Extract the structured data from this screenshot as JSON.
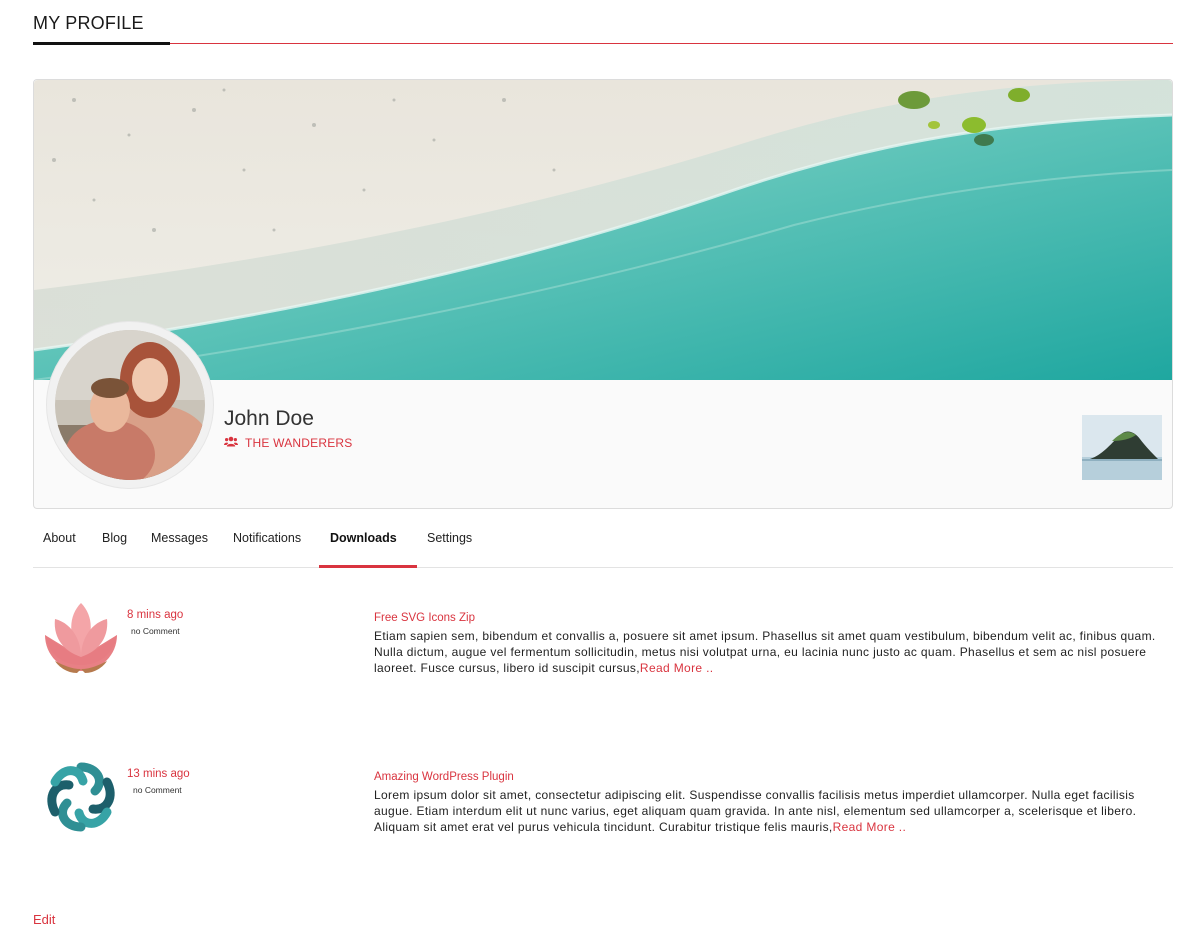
{
  "header": {
    "title": "MY PROFILE"
  },
  "profile": {
    "name": "John Doe",
    "group_label": "THE WANDERERS",
    "group_icon": "users-icon"
  },
  "tabs": [
    {
      "label": "About"
    },
    {
      "label": "Blog"
    },
    {
      "label": "Messages"
    },
    {
      "label": "Notifications"
    },
    {
      "label": "Downloads",
      "active": true
    },
    {
      "label": "Settings"
    }
  ],
  "downloads": [
    {
      "time": "8 mins ago",
      "comments": "no Comment",
      "title": "Free SVG Icons Zip",
      "text": "Etiam sapien sem, bibendum et convallis a, posuere sit amet ipsum. Phasellus sit amet quam vestibulum, bibendum velit ac, finibus quam. Nulla dictum, augue vel fermentum sollicitudin, metus nisi volutpat urna, eu lacinia nunc justo ac quam. Phasellus et sem ac nisl posuere laoreet. Fusce cursus, libero id suscipit cursus,",
      "read_more": "Read More ..",
      "icon": "lotus-icon"
    },
    {
      "time": "13 mins ago",
      "comments": "no Comment",
      "title": "Amazing WordPress Plugin",
      "text": "Lorem ipsum dolor sit amet, consectetur adipiscing elit. Suspendisse convallis facilisis metus imperdiet ullamcorper. Nulla eget facilisis augue. Etiam interdum elit ut nunc varius, eget aliquam quam gravida. In ante nisl, elementum sed ullamcorper a, scelerisque et libero. Aliquam sit amet erat vel purus vehicula tincidunt. Curabitur tristique felis mauris,",
      "read_more": "Read More ..",
      "icon": "knot-icon"
    }
  ],
  "footer": {
    "edit_label": "Edit"
  },
  "colors": {
    "accent": "#d9343f",
    "text": "#222222",
    "border": "#dcdcdc"
  }
}
